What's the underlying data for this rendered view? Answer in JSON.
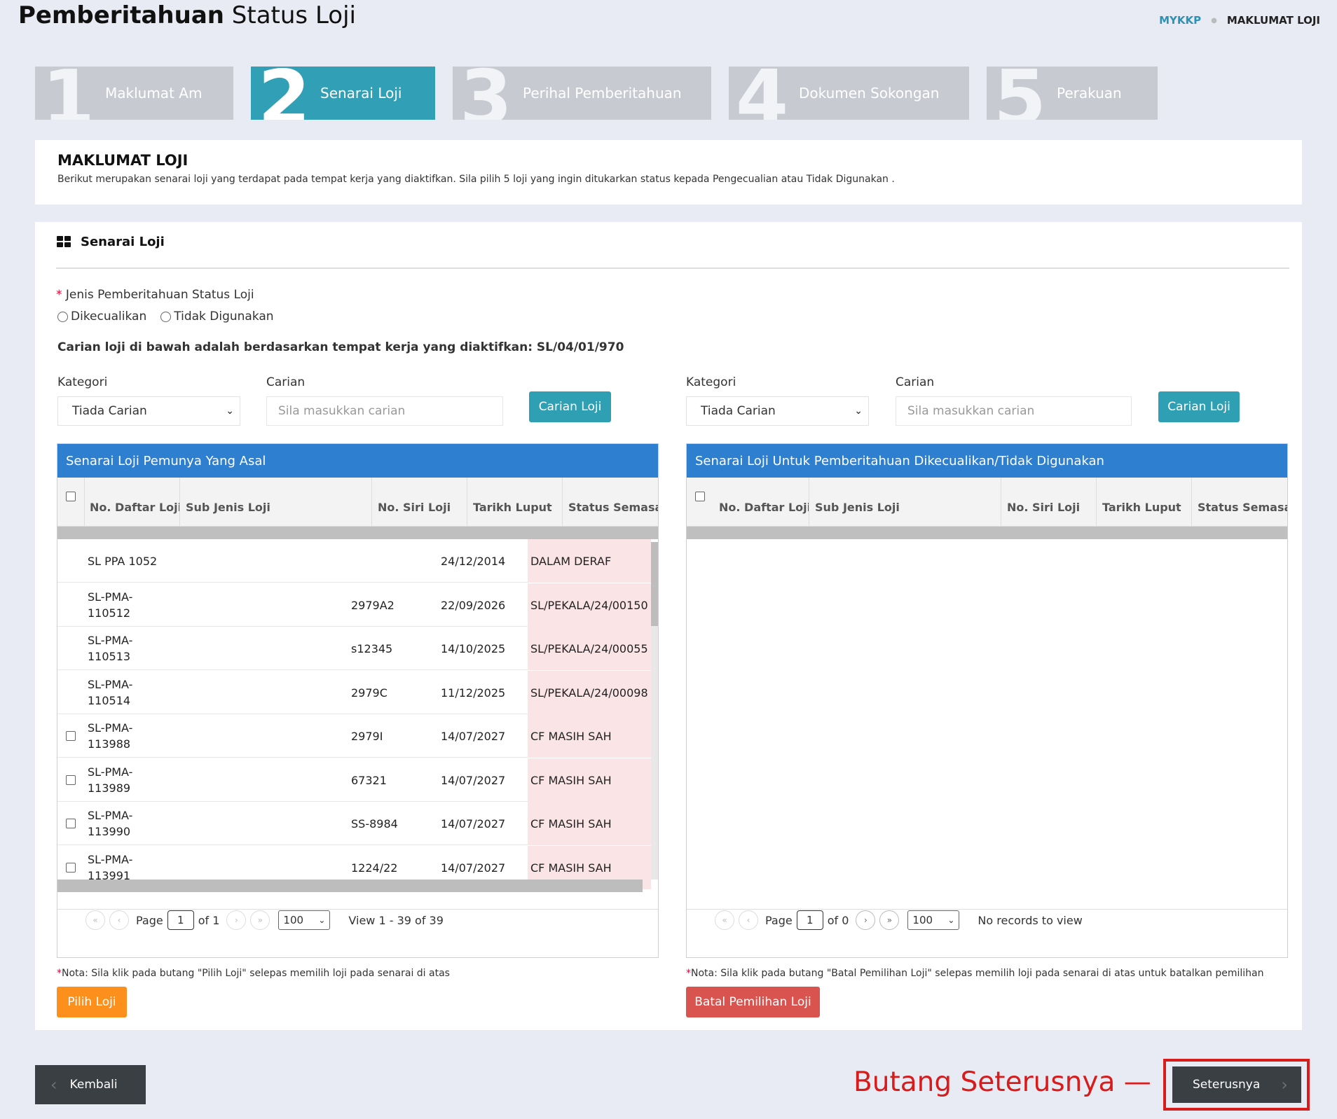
{
  "header": {
    "title_bold": "Pemberitahuan",
    "title_light": "Status Loji",
    "breadcrumb": {
      "link": "MYKKP",
      "current": "MAKLUMAT LOJI"
    }
  },
  "steps": [
    {
      "num": "1",
      "label": "Maklumat Am",
      "active": false
    },
    {
      "num": "2",
      "label": "Senarai Loji",
      "active": true
    },
    {
      "num": "3",
      "label": "Perihal Pemberitahuan",
      "active": false
    },
    {
      "num": "4",
      "label": "Dokumen Sokongan",
      "active": false
    },
    {
      "num": "5",
      "label": "Perakuan",
      "active": false
    }
  ],
  "info": {
    "title": "MAKLUMAT LOJI",
    "description": "Berikut merupakan senarai loji yang terdapat pada tempat kerja yang diaktifkan. Sila pilih 5 loji yang ingin ditukarkan status kepada Pengecualian atau Tidak Digunakan ."
  },
  "section": {
    "title": "Senarai Loji",
    "icon": "grid-icon",
    "jenis_label": "Jenis Pemberitahuan Status Loji",
    "required_mark": "*",
    "radio_options": [
      "Dikecualikan",
      "Tidak Digunakan"
    ],
    "search_note": "Carian loji di bawah adalah berdasarkan tempat kerja yang diaktifkan: SL/04/01/970"
  },
  "left_search": {
    "kategori_label": "Kategori",
    "kategori_value": "Tiada Carian",
    "carian_label": "Carian",
    "carian_placeholder": "Sila masukkan carian",
    "button": "Carian Loji"
  },
  "right_search": {
    "kategori_label": "Kategori",
    "kategori_value": "Tiada Carian",
    "carian_label": "Carian",
    "carian_placeholder": "Sila masukkan carian",
    "button": "Carian Loji"
  },
  "left_grid": {
    "caption": "Senarai Loji Pemunya Yang Asal",
    "columns": [
      "No. Daftar Loji",
      "Sub Jenis Loji",
      "No. Siri Loji",
      "Tarikh Luput",
      "Status Semasa"
    ],
    "rows": [
      {
        "checkbox": false,
        "no_daftar": "SL PPA 1052",
        "sub_jenis": "",
        "no_siri": "",
        "tarikh": "24/12/2014",
        "status": "DALAM DERAF"
      },
      {
        "checkbox": false,
        "no_daftar": "SL-PMA-\n110512",
        "sub_jenis": "",
        "no_siri": "2979A2",
        "tarikh": "22/09/2026",
        "status": "SL/PEKALA/24/00150"
      },
      {
        "checkbox": false,
        "no_daftar": "SL-PMA-\n110513",
        "sub_jenis": "",
        "no_siri": "s12345",
        "tarikh": "14/10/2025",
        "status": "SL/PEKALA/24/00055"
      },
      {
        "checkbox": false,
        "no_daftar": "SL-PMA-\n110514",
        "sub_jenis": "",
        "no_siri": "2979C",
        "tarikh": "11/12/2025",
        "status": "SL/PEKALA/24/00098"
      },
      {
        "checkbox": true,
        "no_daftar": "SL-PMA-\n113988",
        "sub_jenis": "",
        "no_siri": "2979I",
        "tarikh": "14/07/2027",
        "status": "CF MASIH SAH"
      },
      {
        "checkbox": true,
        "no_daftar": "SL-PMA-\n113989",
        "sub_jenis": "",
        "no_siri": "67321",
        "tarikh": "14/07/2027",
        "status": "CF MASIH SAH"
      },
      {
        "checkbox": true,
        "no_daftar": "SL-PMA-\n113990",
        "sub_jenis": "",
        "no_siri": "SS-8984",
        "tarikh": "14/07/2027",
        "status": "CF MASIH SAH"
      },
      {
        "checkbox": true,
        "no_daftar": "SL-PMA-\n113991",
        "sub_jenis": "",
        "no_siri": "1224/22",
        "tarikh": "14/07/2027",
        "status": "CF MASIH SAH"
      }
    ],
    "pager": {
      "page_label": "Page",
      "page_value": "1",
      "of_label": "of 1",
      "page_size": "100",
      "view_text": "View 1 - 39 of 39"
    }
  },
  "right_grid": {
    "caption": "Senarai Loji Untuk Pemberitahuan Dikecualikan/Tidak Digunakan",
    "columns": [
      "No. Daftar Loji",
      "Sub Jenis Loji",
      "No. Siri Loji",
      "Tarikh Luput",
      "Status Semasa"
    ],
    "pager": {
      "page_label": "Page",
      "page_value": "1",
      "of_label": "of 0",
      "page_size": "100",
      "view_text": "No records to view"
    }
  },
  "left_note": {
    "star": "*",
    "text": "Nota: Sila klik pada butang \"Pilih Loji\" selepas memilih loji pada senarai di atas"
  },
  "right_note": {
    "star": "*",
    "text": "Nota: Sila klik pada butang \"Batal Pemilihan Loji\" selepas memilih loji pada senarai di atas untuk batalkan pemilihan"
  },
  "buttons": {
    "pilih": "Pilih Loji",
    "batal": "Batal Pemilihan Loji",
    "kembali": "Kembali",
    "seterusnya": "Seterusnya"
  },
  "annotation": {
    "text": "Butang Seterusnya —",
    "color": "#d81b1b"
  },
  "colors": {
    "accent": "#319fb6",
    "grid_caption": "#2e7fd0",
    "orange": "#fd8f1c",
    "red": "#d9534f",
    "dark": "#3a3f44"
  }
}
